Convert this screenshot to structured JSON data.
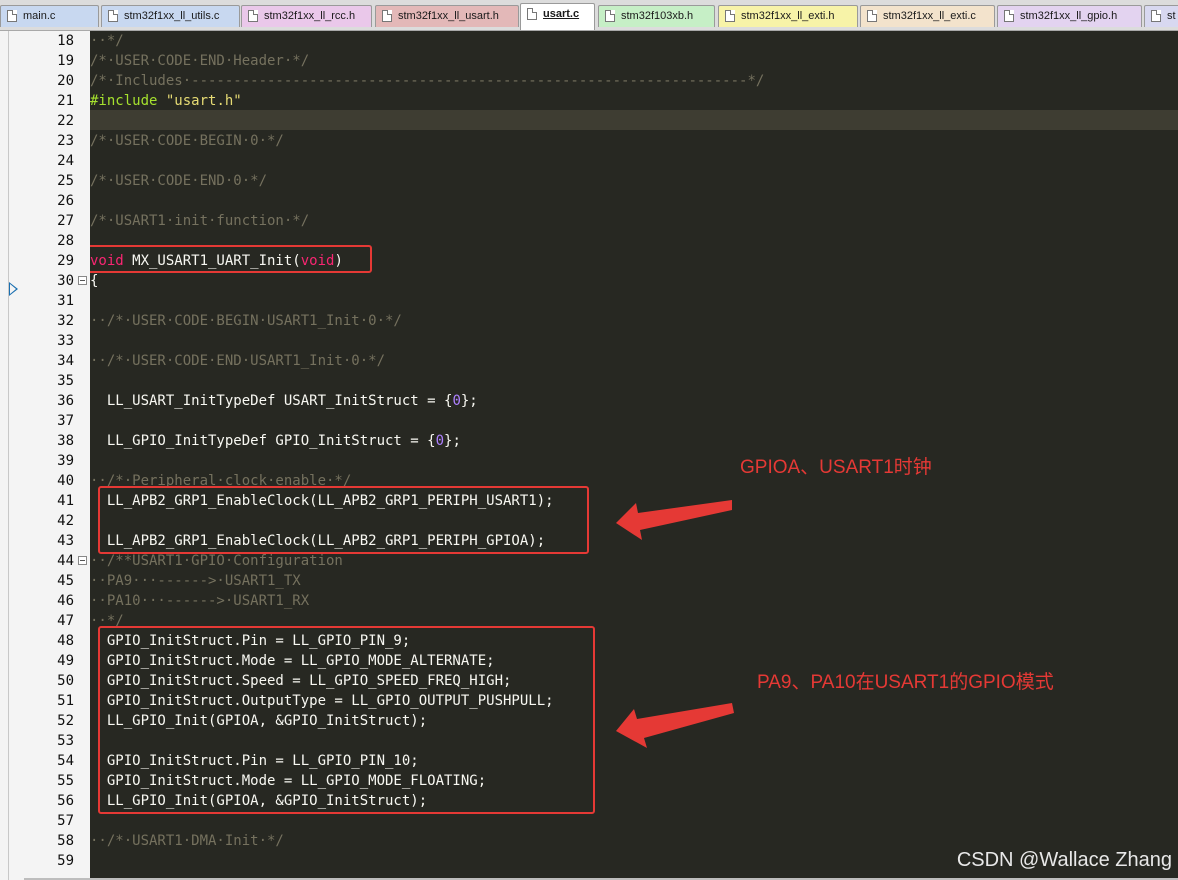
{
  "tabs": [
    {
      "label": "main.c",
      "color": "#c8d8f0",
      "active": false
    },
    {
      "label": "stm32f1xx_ll_utils.c",
      "color": "#c8d8f0",
      "active": false
    },
    {
      "label": "stm32f1xx_ll_rcc.h",
      "color": "#eac8ea",
      "active": false
    },
    {
      "label": "stm32f1xx_ll_usart.h",
      "color": "#e3b8b8",
      "active": false
    },
    {
      "label": "usart.c",
      "color": "#ffffff",
      "active": true
    },
    {
      "label": "stm32f103xb.h",
      "color": "#c6efc6",
      "active": false
    },
    {
      "label": "stm32f1xx_ll_exti.h",
      "color": "#f7f3a8",
      "active": false
    },
    {
      "label": "stm32f1xx_ll_exti.c",
      "color": "#f3e3cc",
      "active": false
    },
    {
      "label": "stm32f1xx_ll_gpio.h",
      "color": "#e3d3f0",
      "active": false
    },
    {
      "label": "st",
      "color": "#d8d8f0",
      "active": false
    }
  ],
  "line_numbers": [
    "18",
    "19",
    "20",
    "21",
    "22",
    "23",
    "24",
    "25",
    "26",
    "27",
    "28",
    "29",
    "30",
    "31",
    "32",
    "33",
    "34",
    "35",
    "36",
    "37",
    "38",
    "39",
    "40",
    "41",
    "42",
    "43",
    "44",
    "45",
    "46",
    "47",
    "48",
    "49",
    "50",
    "51",
    "52",
    "53",
    "54",
    "55",
    "56",
    "57",
    "58",
    "59"
  ],
  "current_line": "29",
  "code_lines": [
    [
      {
        "t": "··*/",
        "c": "cm"
      }
    ],
    [
      {
        "t": "/*·USER·CODE·END·Header·*/",
        "c": "cm"
      }
    ],
    [
      {
        "t": "/*·Includes·------------------------------------------------------------------*/",
        "c": "cm"
      }
    ],
    [
      {
        "t": "#include",
        "c": "pp"
      },
      {
        "t": " "
      },
      {
        "t": "\"usart.h\"",
        "c": "str"
      }
    ],
    [],
    [
      {
        "t": "/*·USER·CODE·BEGIN·0·*/",
        "c": "cm"
      }
    ],
    [],
    [
      {
        "t": "/*·USER·CODE·END·0·*/",
        "c": "cm"
      }
    ],
    [],
    [
      {
        "t": "/*·USART1·init·function·*/",
        "c": "cm"
      }
    ],
    [],
    [
      {
        "t": "void",
        "c": "kw"
      },
      {
        "t": " MX_USART1_UART_Init("
      },
      {
        "t": "void",
        "c": "kw"
      },
      {
        "t": ")"
      }
    ],
    [
      {
        "t": "{"
      }
    ],
    [],
    [
      {
        "t": "··/*·USER·CODE·BEGIN·USART1_Init·0·*/",
        "c": "cm"
      }
    ],
    [],
    [
      {
        "t": "··/*·USER·CODE·END·USART1_Init·0·*/",
        "c": "cm"
      }
    ],
    [],
    [
      {
        "t": "  LL_USART_InitTypeDef USART_InitStruct = {"
      },
      {
        "t": "0",
        "c": "num"
      },
      {
        "t": "};"
      }
    ],
    [],
    [
      {
        "t": "  LL_GPIO_InitTypeDef GPIO_InitStruct = {"
      },
      {
        "t": "0",
        "c": "num"
      },
      {
        "t": "};"
      }
    ],
    [],
    [
      {
        "t": "··/*·Peripheral·clock·enable·*/",
        "c": "cm"
      }
    ],
    [
      {
        "t": "  LL_APB2_GRP1_EnableClock(LL_APB2_GRP1_PERIPH_USART1);"
      }
    ],
    [],
    [
      {
        "t": "  LL_APB2_GRP1_EnableClock(LL_APB2_GRP1_PERIPH_GPIOA);"
      }
    ],
    [
      {
        "t": "··/**USART1·GPIO·Configuration",
        "c": "cm"
      }
    ],
    [
      {
        "t": "··PA9···------>·USART1_TX",
        "c": "cm"
      }
    ],
    [
      {
        "t": "··PA10···------>·USART1_RX",
        "c": "cm"
      }
    ],
    [
      {
        "t": "··*/",
        "c": "cm"
      }
    ],
    [
      {
        "t": "  GPIO_InitStruct.Pin = LL_GPIO_PIN_9;"
      }
    ],
    [
      {
        "t": "  GPIO_InitStruct.Mode = LL_GPIO_MODE_ALTERNATE;"
      }
    ],
    [
      {
        "t": "  GPIO_InitStruct.Speed = LL_GPIO_SPEED_FREQ_HIGH;"
      }
    ],
    [
      {
        "t": "  GPIO_InitStruct.OutputType = LL_GPIO_OUTPUT_PUSHPULL;"
      }
    ],
    [
      {
        "t": "  LL_GPIO_Init(GPIOA, &GPIO_InitStruct);"
      }
    ],
    [],
    [
      {
        "t": "  GPIO_InitStruct.Pin = LL_GPIO_PIN_10;"
      }
    ],
    [
      {
        "t": "  GPIO_InitStruct.Mode = LL_GPIO_MODE_FLOATING;"
      }
    ],
    [
      {
        "t": "  LL_GPIO_Init(GPIOA, &GPIO_InitStruct);"
      }
    ],
    [],
    [
      {
        "t": "··/*·USART1·DMA·Init·*/",
        "c": "cm"
      }
    ],
    []
  ],
  "annotations": {
    "clock_note": "GPIOA、USART1时钟",
    "gpio_note": "PA9、PA10在USART1的GPIO模式"
  },
  "watermark": "CSDN @Wallace Zhang",
  "colors": {
    "editor_bg": "#272822",
    "annotation_red": "#e53935"
  }
}
